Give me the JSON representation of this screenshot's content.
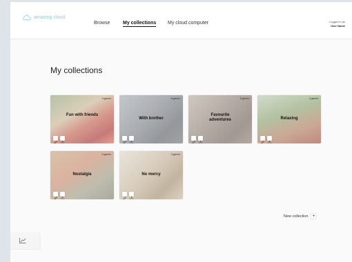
{
  "app": {
    "logo_text": "amazing cloud"
  },
  "nav": {
    "items": [
      "Browse",
      "My collections",
      "My cloud computer"
    ],
    "active": "My collections"
  },
  "user": {
    "line1": "Logged in as",
    "line2": "User Name"
  },
  "page": {
    "title": "My collections"
  },
  "collections": [
    {
      "name": "Fun with friends",
      "count": "4 games"
    },
    {
      "name": "With brother",
      "count": "6 games"
    },
    {
      "name": "Favourite adventures",
      "count": "5 games"
    },
    {
      "name": "Relaxing",
      "count": "2 games"
    },
    {
      "name": "Nostalgia",
      "count": "4 games"
    },
    {
      "name": "No mercy",
      "count": "3 games"
    }
  ],
  "actions": {
    "new_collection": "New collection",
    "plus": "+"
  },
  "icons": {
    "logo": "cloud-icon",
    "edit": "edit-icon",
    "share": "share-icon",
    "side": "chart-icon"
  },
  "colors": {
    "accent": "#8fc9dc",
    "background": "#fafafa"
  }
}
